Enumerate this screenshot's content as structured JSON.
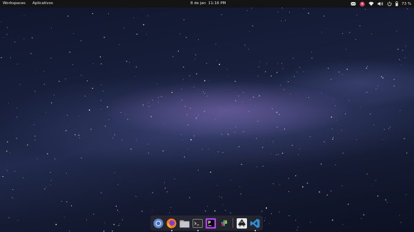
{
  "topbar": {
    "workspaces_label": "Workspaces",
    "apps_label": "Aplicativos",
    "date": "8 de jan",
    "time": "11:16 PM",
    "battery_percent": "73 %"
  },
  "tray": {
    "icons": [
      "discord-icon",
      "avatar-icon",
      "wifi-icon",
      "volume-icon",
      "power-icon",
      "battery-icon"
    ]
  },
  "dock": {
    "apps": [
      {
        "name": "chromium",
        "icon": "chromium-icon",
        "running": false
      },
      {
        "name": "firefox",
        "icon": "firefox-icon",
        "running": true
      },
      {
        "name": "files",
        "icon": "folder-icon",
        "running": false
      },
      {
        "name": "terminal",
        "icon": "terminal-icon",
        "running": true
      },
      {
        "name": "phpstorm",
        "icon": "phpstorm-icon",
        "running": false
      },
      {
        "name": "slack",
        "icon": "slack-icon",
        "running": false
      },
      {
        "name": "inkscape",
        "icon": "inkscape-icon",
        "running": false
      },
      {
        "name": "vscode",
        "icon": "vscode-icon",
        "running": true
      }
    ]
  },
  "colors": {
    "topbar_bg": "#141414",
    "sky_dark": "#10162c",
    "milkyway": "#6b6fb0"
  }
}
